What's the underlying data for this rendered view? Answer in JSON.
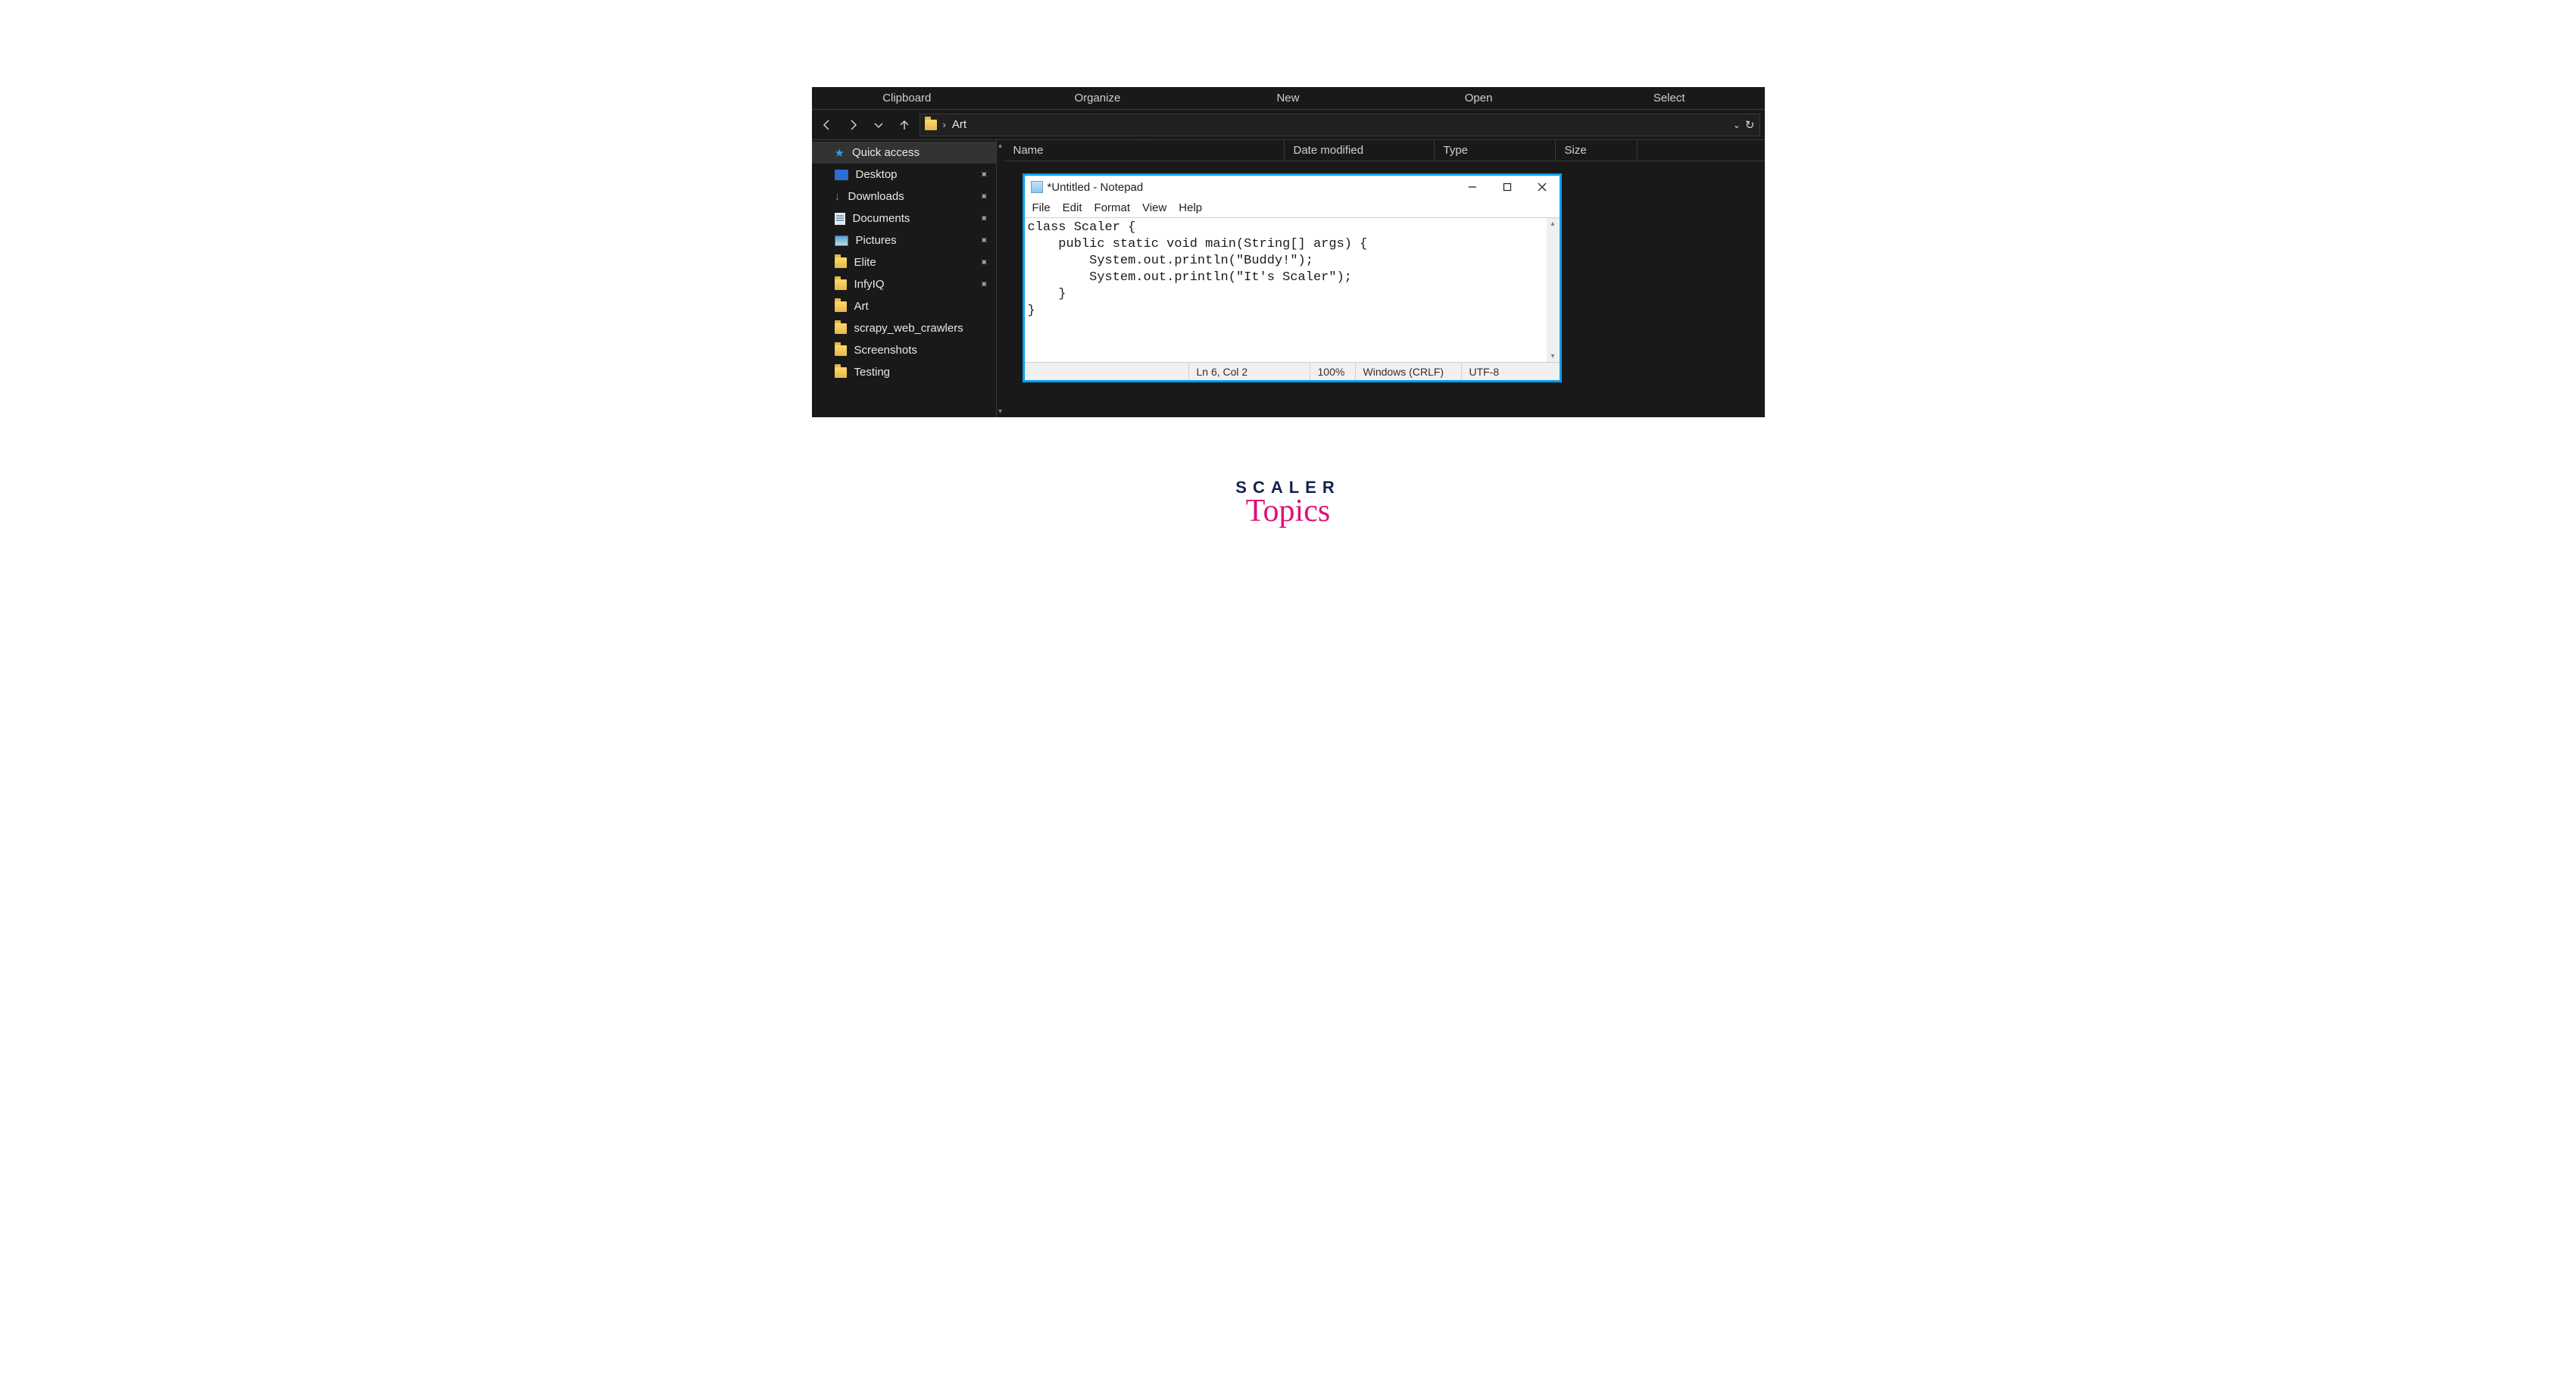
{
  "ribbon": {
    "tabs": [
      "Clipboard",
      "Organize",
      "New",
      "Open",
      "Select"
    ]
  },
  "navbar": {
    "current_folder": "Art"
  },
  "sidebar": {
    "items": [
      {
        "label": "Quick access",
        "type": "header",
        "pinned": false
      },
      {
        "label": "Desktop",
        "type": "desktop",
        "pinned": true
      },
      {
        "label": "Downloads",
        "type": "download",
        "pinned": true
      },
      {
        "label": "Documents",
        "type": "document",
        "pinned": true
      },
      {
        "label": "Pictures",
        "type": "picture",
        "pinned": true
      },
      {
        "label": "Elite",
        "type": "folder",
        "pinned": true
      },
      {
        "label": "InfyIQ",
        "type": "folder",
        "pinned": true
      },
      {
        "label": "Art",
        "type": "folder",
        "pinned": false
      },
      {
        "label": "scrapy_web_crawlers",
        "type": "folder",
        "pinned": false
      },
      {
        "label": "Screenshots",
        "type": "folder",
        "pinned": false
      },
      {
        "label": "Testing",
        "type": "folder",
        "pinned": false
      }
    ]
  },
  "columns": {
    "name": "Name",
    "date": "Date modified",
    "type": "Type",
    "size": "Size"
  },
  "notepad": {
    "title": "*Untitled - Notepad",
    "menu": [
      "File",
      "Edit",
      "Format",
      "View",
      "Help"
    ],
    "content": "class Scaler {\n    public static void main(String[] args) {\n        System.out.println(\"Buddy!\");\n        System.out.println(\"It's Scaler\");\n    }\n}",
    "status": {
      "position": "Ln 6, Col 2",
      "zoom": "100%",
      "line_ending": "Windows (CRLF)",
      "encoding": "UTF-8"
    }
  },
  "branding": {
    "line1": "SCALER",
    "line2": "Topics"
  }
}
